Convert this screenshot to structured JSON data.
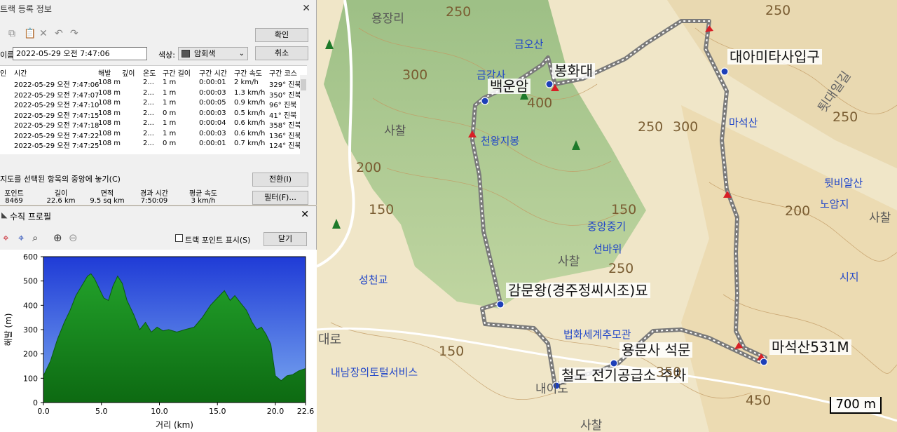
{
  "track_dialog": {
    "title": "트랙 등록 정보",
    "close": "✕",
    "confirm_label": "확인",
    "cancel_label": "취소",
    "name_label": "이름:",
    "name_value": "2022-05-29 오전 7:47:06",
    "color_label": "색상:",
    "color_value": "암회색",
    "color_hex": "#555555",
    "columns": [
      "인",
      "시간",
      "해발",
      "깊이",
      "온도",
      "구간 길이",
      "구간 시간",
      "구간 속도",
      "구간 코스"
    ],
    "rows": [
      {
        "time": "2022-05-29 오전 7:47:06",
        "alt": "108 m",
        "depth": "",
        "temp": "2...",
        "len": "1 m",
        "dur": "0:00:01",
        "speed": "2 km/h",
        "course": "329° 진북"
      },
      {
        "time": "2022-05-29 오전 7:47:07",
        "alt": "108 m",
        "depth": "",
        "temp": "2...",
        "len": "1 m",
        "dur": "0:00:03",
        "speed": "1.3 km/h",
        "course": "350° 진북"
      },
      {
        "time": "2022-05-29 오전 7:47:10",
        "alt": "108 m",
        "depth": "",
        "temp": "2...",
        "len": "1 m",
        "dur": "0:00:05",
        "speed": "0.9 km/h",
        "course": "96° 진북"
      },
      {
        "time": "2022-05-29 오전 7:47:15",
        "alt": "108 m",
        "depth": "",
        "temp": "2...",
        "len": "0 m",
        "dur": "0:00:03",
        "speed": "0.5 km/h",
        "course": "41° 진북"
      },
      {
        "time": "2022-05-29 오전 7:47:18",
        "alt": "108 m",
        "depth": "",
        "temp": "2...",
        "len": "1 m",
        "dur": "0:00:04",
        "speed": "0.6 km/h",
        "course": "358° 진북"
      },
      {
        "time": "2022-05-29 오전 7:47:22",
        "alt": "108 m",
        "depth": "",
        "temp": "2...",
        "len": "1 m",
        "dur": "0:00:03",
        "speed": "0.6 km/h",
        "course": "136° 진북"
      },
      {
        "time": "2022-05-29 오전 7:47:25",
        "alt": "108 m",
        "depth": "",
        "temp": "2...",
        "len": "0 m",
        "dur": "0:00:01",
        "speed": "0.7 km/h",
        "course": "124° 진북"
      }
    ],
    "center_label": "지도를 선택된 항목의 중앙에 놓기(C)",
    "switch_label": "전환(I)",
    "filter_label": "필터(F)...",
    "summary_headers": [
      "포인트",
      "길이",
      "면적",
      "경과 시간",
      "평균 속도"
    ],
    "summary_values": [
      "8469",
      "22.6 km",
      "9.5 sq km",
      "7:50:09",
      "3 km/h"
    ]
  },
  "profile": {
    "title": "수직 프로필",
    "close": "✕",
    "show_points_label": "트랙 포인트 표시(S)",
    "close_btn": "닫기",
    "tools": [
      "select-target-icon",
      "pan-target-icon",
      "zoom-region-icon",
      "zoom-in-icon",
      "zoom-out-icon"
    ]
  },
  "chart_data": {
    "type": "area",
    "xlabel": "거리   (km)",
    "ylabel": "해발 (m)",
    "xlim": [
      0,
      22.6
    ],
    "ylim": [
      0,
      600
    ],
    "xticks": [
      "0.0",
      "5.0",
      "10.0",
      "15.0",
      "20.0",
      "22.6"
    ],
    "yticks": [
      "0",
      "100",
      "200",
      "300",
      "400",
      "500",
      "600"
    ],
    "x": [
      0,
      0.6,
      1.2,
      1.8,
      2.3,
      2.8,
      3.3,
      3.8,
      4.1,
      4.4,
      4.8,
      5.2,
      5.6,
      6.0,
      6.4,
      6.8,
      7.2,
      7.8,
      8.3,
      8.8,
      9.3,
      9.8,
      10.3,
      10.8,
      11.5,
      12.2,
      13.0,
      13.7,
      14.4,
      15.0,
      15.6,
      16.1,
      16.5,
      17.0,
      17.5,
      18.0,
      18.4,
      18.8,
      19.2,
      19.6,
      20.0,
      20.5,
      21.0,
      21.5,
      22.0,
      22.6
    ],
    "y": [
      110,
      170,
      260,
      330,
      380,
      440,
      480,
      520,
      530,
      510,
      470,
      430,
      420,
      480,
      520,
      490,
      420,
      360,
      300,
      330,
      290,
      310,
      295,
      300,
      290,
      300,
      310,
      350,
      400,
      430,
      460,
      420,
      440,
      410,
      380,
      330,
      300,
      310,
      280,
      240,
      110,
      90,
      110,
      115,
      130,
      140
    ],
    "fill_top": "#22a02a",
    "fill_bottom": "#0d6a12",
    "bg_top": "#1f3bd6",
    "bg_bottom": "#7aa8f0"
  },
  "map": {
    "track_color": "#7a7a7a",
    "labels": {
      "yongjangri": "용장리",
      "geumosan": "금오산",
      "geumgangsa": "금강사",
      "bonghwadae": "봉화대",
      "baegunam": "백운암",
      "daeamitabul": "대아미타사입구",
      "maseoksan_blue": "마석산",
      "toedaeil": "툇대일길",
      "cheonwangjibong": "천왕지봉",
      "sachal1": "사찰",
      "jungangjoong": "중앙중기",
      "seonbawi": "선바위",
      "sachal2": "사찰",
      "seongcheongyo": "성천교",
      "gammunwang": "감문왕(경주정씨시조)묘",
      "beophwa": "법화세계추모관",
      "yongmunsa": "용문사 석문",
      "cheoldo": "철도 전기공급소 주차",
      "naenam": "내남장의토털서비스",
      "maseoksan531": "마석산531M",
      "twibialsan": "뒷비알산",
      "noamji": "노암지",
      "sachal3": "사찰",
      "siji": "시지",
      "sachal4": "사찰",
      "naeido": "내이도",
      "daero": "대로",
      "scale": "700 m"
    }
  }
}
